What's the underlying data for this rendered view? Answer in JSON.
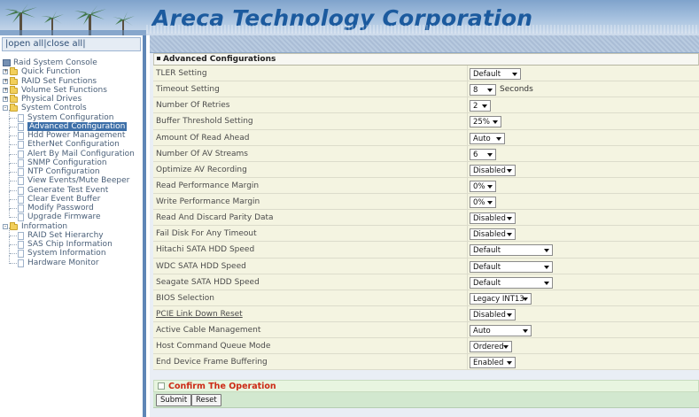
{
  "banner": {
    "company": "Areca Technology Corporation"
  },
  "left": {
    "open_all": "open all",
    "separator": "|",
    "close_all": "close all",
    "tree": [
      {
        "label": "Raid System Console",
        "type": "root"
      },
      {
        "label": "Quick Function",
        "type": "folder",
        "expanded": false
      },
      {
        "label": "RAID Set Functions",
        "type": "folder",
        "expanded": false
      },
      {
        "label": "Volume Set Functions",
        "type": "folder",
        "expanded": false
      },
      {
        "label": "Physical Drives",
        "type": "folder",
        "expanded": false
      },
      {
        "label": "System Controls",
        "type": "folder",
        "expanded": true
      },
      {
        "label": "System Configuration",
        "type": "page"
      },
      {
        "label": "Advanced Configuration",
        "type": "page",
        "selected": true
      },
      {
        "label": "Hdd Power Management",
        "type": "page"
      },
      {
        "label": "EtherNet Configuration",
        "type": "page"
      },
      {
        "label": "Alert By Mail Configuration",
        "type": "page"
      },
      {
        "label": "SNMP Configuration",
        "type": "page"
      },
      {
        "label": "NTP Configuration",
        "type": "page"
      },
      {
        "label": "View Events/Mute Beeper",
        "type": "page"
      },
      {
        "label": "Generate Test Event",
        "type": "page"
      },
      {
        "label": "Clear Event Buffer",
        "type": "page"
      },
      {
        "label": "Modify Password",
        "type": "page"
      },
      {
        "label": "Upgrade Firmware",
        "type": "page"
      },
      {
        "label": "Information",
        "type": "folder",
        "expanded": true
      },
      {
        "label": "RAID Set Hierarchy",
        "type": "page"
      },
      {
        "label": "SAS Chip Information",
        "type": "page"
      },
      {
        "label": "System Information",
        "type": "page"
      },
      {
        "label": "Hardware Monitor",
        "type": "page"
      }
    ]
  },
  "main": {
    "section_title": "Advanced Configurations",
    "rows": [
      {
        "label": "TLER Setting",
        "value": "Default"
      },
      {
        "label": "Timeout Setting",
        "value": "8",
        "unit": "Seconds"
      },
      {
        "label": "Number Of Retries",
        "value": "2"
      },
      {
        "label": "Buffer Threshold Setting",
        "value": "25%"
      },
      {
        "label": "Amount Of Read Ahead",
        "value": "Auto"
      },
      {
        "label": "Number Of AV Streams",
        "value": "6"
      },
      {
        "label": "Optimize AV Recording",
        "value": "Disabled"
      },
      {
        "label": "Read Performance Margin",
        "value": "0%"
      },
      {
        "label": "Write Performance Margin",
        "value": "0%"
      },
      {
        "label": "Read And Discard Parity Data",
        "value": "Disabled"
      },
      {
        "label": "Fail Disk For Any Timeout",
        "value": "Disabled"
      },
      {
        "label": "Hitachi SATA HDD Speed",
        "value": "Default"
      },
      {
        "label": "WDC SATA HDD Speed",
        "value": "Default"
      },
      {
        "label": "Seagate SATA HDD Speed",
        "value": "Default"
      },
      {
        "label": "BIOS Selection",
        "value": "Legacy INT13"
      },
      {
        "label": "PCIE Link Down Reset",
        "value": "Disabled",
        "link": true
      },
      {
        "label": "Active Cable Management",
        "value": "Auto"
      },
      {
        "label": "Host Command Queue Mode",
        "value": "Ordered"
      },
      {
        "label": "End Device Frame Buffering",
        "value": "Enabled"
      }
    ],
    "confirm_label": "Confirm The Operation",
    "submit_label": "Submit",
    "reset_label": "Reset"
  },
  "colors": {
    "banner_text": "#1b5a9e",
    "row_bg": "#f4f4e1",
    "confirm_text": "#cc2a16",
    "confirm_bg": "#e8f5e0",
    "selected_bg": "#3d6fa8"
  }
}
